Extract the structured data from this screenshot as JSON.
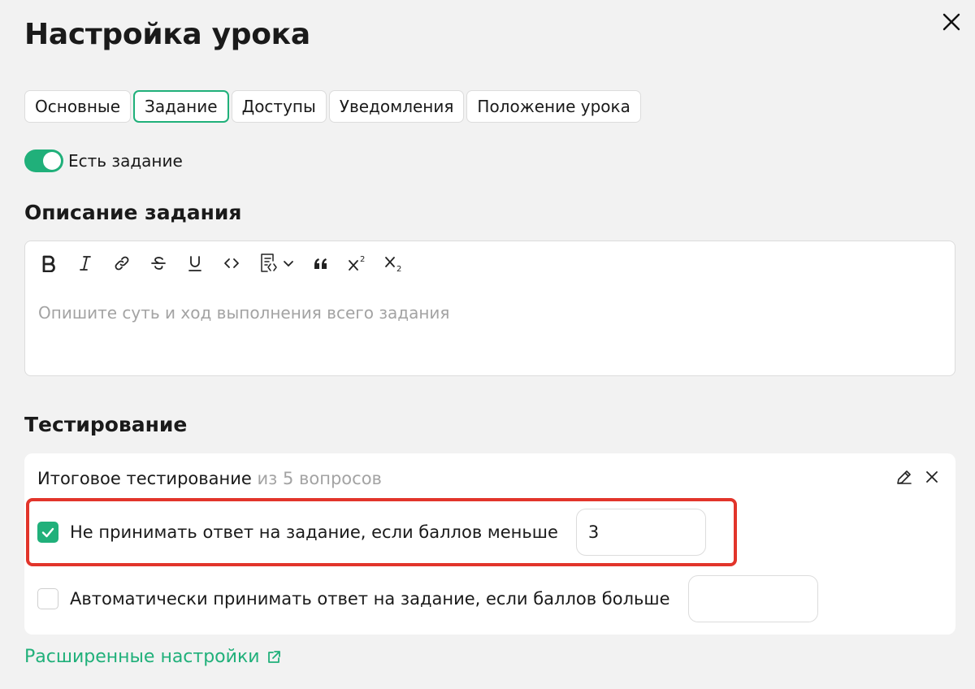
{
  "dialog": {
    "title": "Настройка урока"
  },
  "tabs": [
    {
      "label": "Основные",
      "active": false
    },
    {
      "label": "Задание",
      "active": true
    },
    {
      "label": "Доступы",
      "active": false
    },
    {
      "label": "Уведомления",
      "active": false
    },
    {
      "label": "Положение урока",
      "active": false
    }
  ],
  "task_toggle": {
    "label": "Есть задание",
    "on": true
  },
  "description": {
    "heading": "Описание задания",
    "placeholder": "Опишите суть и ход выполнения всего задания",
    "toolbar": [
      "bold-icon",
      "italic-icon",
      "link-icon",
      "strikethrough-icon",
      "underline-icon",
      "code-icon",
      "code-block-icon",
      "quote-icon",
      "superscript-icon",
      "subscript-icon"
    ]
  },
  "testing": {
    "heading": "Тестирование",
    "title": "Итоговое тестирование",
    "questions_note": "из 5 вопросов",
    "rules": [
      {
        "label": "Не принимать ответ на задание, если баллов меньше",
        "checked": true,
        "value": "3"
      },
      {
        "label": "Автоматически принимать ответ на задание, если баллов больше",
        "checked": false,
        "value": ""
      }
    ]
  },
  "advanced_link": {
    "label": "Расширенные настройки"
  },
  "colors": {
    "accent": "#20b07a",
    "highlight": "#e2352b",
    "muted_text": "#a3a3a3"
  }
}
